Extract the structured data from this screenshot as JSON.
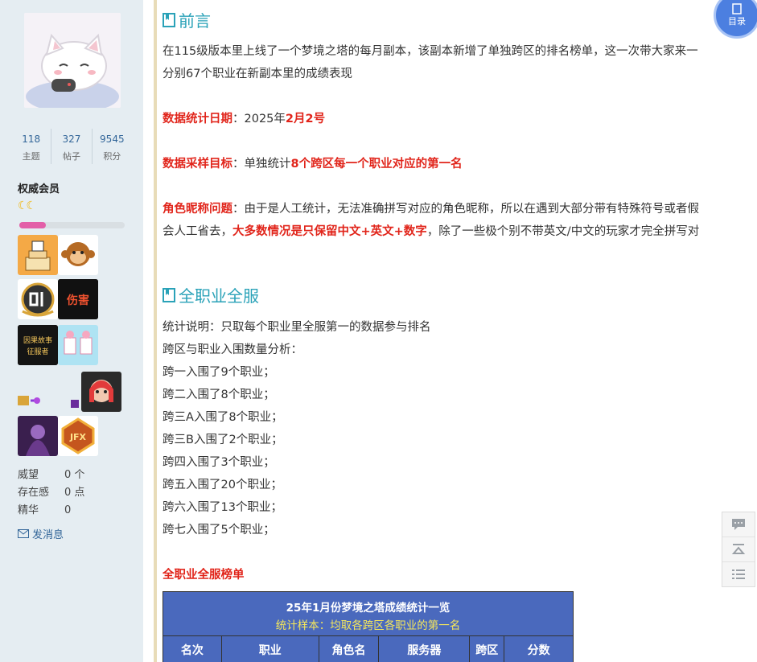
{
  "profile": {
    "stats": [
      {
        "num": "118",
        "label": "主题"
      },
      {
        "num": "327",
        "label": "帖子"
      },
      {
        "num": "9545",
        "label": "积分"
      }
    ],
    "group": "权威会员",
    "level_progress": 0.25,
    "medal_texts": [
      "伤害",
      "因果故事征服者",
      "JFX"
    ],
    "meta": [
      {
        "k": "威望",
        "v": "0 个"
      },
      {
        "k": "存在感",
        "v": "0 点"
      },
      {
        "k": "精华",
        "v": "0"
      }
    ],
    "send_message": "发消息"
  },
  "article": {
    "sec1_title": "前言",
    "intro_line1": "在115级版本里上线了一个梦境之塔的每月副本，该副本新增了单独跨区的排名榜单，这一次带大家来一",
    "intro_line2": "分别67个职业在新副本里的成绩表现",
    "date_label": "数据统计日期",
    "date_sep": "：2025年",
    "date_value": "2月2号",
    "target_label": "数据采样目标",
    "target_sep": "：单独统计",
    "target_value": "8个跨区每一个职业对应的第一名",
    "name_label": "角色昵称问题",
    "name_text1": "：由于是人工统计，无法准确拼写对应的角色昵称，所以在遇到大部分带有特殊符号或者假",
    "name_text2a": "会人工省去，",
    "name_text2b": "大多数情况是只保留中文+英文+数字",
    "name_text2c": "，除了一些极个别不带英文/中文的玩家才完全拼写对",
    "sec2_title": "全职业全服",
    "stat_note": "统计说明：只取每个职业里全服第一的数据参与排名",
    "analysis_title": "跨区与职业入围数量分析：",
    "regions": [
      "跨一入围了9个职业；",
      "跨二入围了8个职业；",
      "跨三A入围了8个职业；",
      "跨三B入围了2个职业；",
      "跨四入围了3个职业；",
      "跨五入围了20个职业；",
      "跨六入围了13个职业；",
      "跨七入围了5个职业；"
    ],
    "ranking_title": "全职业全服榜单"
  },
  "table": {
    "title": "25年1月份梦境之塔成绩统计一览",
    "subtitle": "统计样本：均取各跨区各职业的第一名",
    "columns": [
      "名次",
      "职业",
      "角色名",
      "服务器",
      "跨区",
      "分数"
    ]
  },
  "toc_label": "目录",
  "colors": {
    "accent": "#2aa2b8",
    "emphasis": "#e1251b",
    "table_bg": "#4a69bd"
  }
}
